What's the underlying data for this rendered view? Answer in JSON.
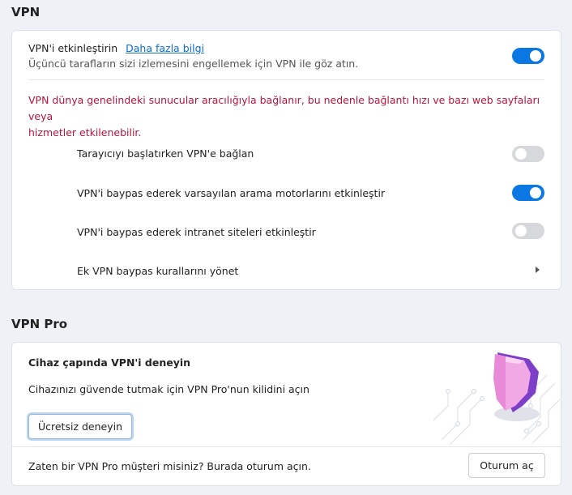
{
  "vpn": {
    "title": "VPN",
    "enable_label": "VPN'i etkinleştirin",
    "learn_more": "Daha fazla bilgi",
    "enable_desc": "Üçüncü tarafların sizi izlemesini engellemek için VPN ile göz atın.",
    "enable_on": true,
    "warning_line1": "VPN dünya genelindeki sunucular aracılığıyla bağlanır, bu nedenle bağlantı hızı ve bazı web sayfaları veya",
    "warning_line2": "hizmetler etkilenebilir.",
    "options": [
      {
        "label": "Tarayıcıyı başlatırken VPN'e bağlan",
        "on": false
      },
      {
        "label": "VPN'i baypas ederek varsayılan arama motorlarını etkinleştir",
        "on": true
      },
      {
        "label": "VPN'i baypas ederek intranet siteleri etkinleştir",
        "on": false
      }
    ],
    "manage_rules": "Ek VPN baypas kurallarını yönet"
  },
  "vpn_pro": {
    "title": "VPN Pro",
    "heading": "Cihaz çapında VPN'i deneyin",
    "desc": "Cihazınızı güvende tutmak için VPN Pro'nun kilidini açın",
    "try_button": "Ücretsiz deneyin",
    "signin_text": "Zaten bir VPN Pro müşteri misiniz? Burada oturum açın.",
    "signin_button": "Oturum aç"
  },
  "colors": {
    "accent": "#0b77e3",
    "warning": "#b8133a",
    "link": "#0b6cd8"
  },
  "icons": [
    "chevron-right-icon",
    "shield-illustration"
  ]
}
